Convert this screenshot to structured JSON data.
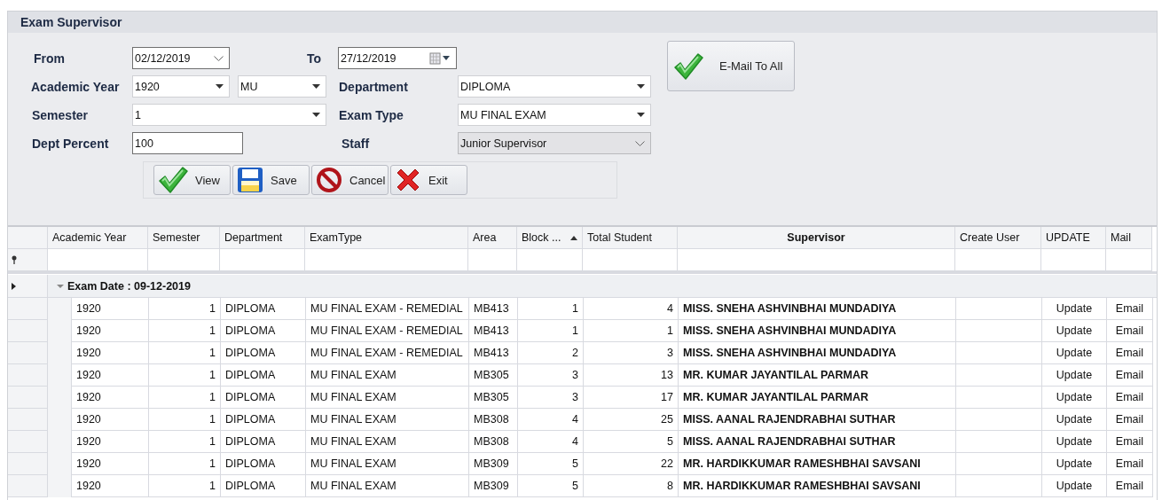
{
  "window": {
    "title": "Exam Supervisor"
  },
  "filters": {
    "from": {
      "label": "From",
      "value": "02/12/2019",
      "kind": "date-dropdown"
    },
    "to": {
      "label": "To",
      "value": "27/12/2019",
      "kind": "date-picker"
    },
    "academic_year": {
      "label": "Academic Year",
      "value": "1920",
      "kind": "combo"
    },
    "university": {
      "value": "MU",
      "kind": "combo"
    },
    "department": {
      "label": "Department",
      "value": "DIPLOMA",
      "kind": "combo"
    },
    "semester": {
      "label": "Semester",
      "value": "1",
      "kind": "combo"
    },
    "exam_type": {
      "label": "Exam Type",
      "value": "MU FINAL EXAM",
      "kind": "combo"
    },
    "dept_percent": {
      "label": "Dept Percent",
      "value": "100",
      "kind": "text"
    },
    "staff": {
      "label": "Staff",
      "value": "Junior Supervisor",
      "kind": "lookup"
    }
  },
  "buttons": [
    {
      "label": "View",
      "kind": "check"
    },
    {
      "label": "Save",
      "kind": "save"
    },
    {
      "label": "Cancel",
      "kind": "cancel"
    },
    {
      "label": "Exit",
      "kind": "exit"
    }
  ],
  "email_button": {
    "label": "E-Mail To All",
    "kind": "check"
  },
  "table": {
    "columns": [
      {
        "label": "Academic Year",
        "kind": "text",
        "sorted": false
      },
      {
        "label": "Semester",
        "kind": "number",
        "sorted": false
      },
      {
        "label": "Department",
        "kind": "text",
        "sorted": false
      },
      {
        "label": "ExamType",
        "kind": "text",
        "sorted": false
      },
      {
        "label": "Area",
        "kind": "text",
        "sorted": false
      },
      {
        "label": "Block ...",
        "kind": "number",
        "sorted": true
      },
      {
        "label": "Total Student",
        "kind": "number",
        "sorted": false
      },
      {
        "label": "Supervisor",
        "kind": "name",
        "sorted": false
      },
      {
        "label": "Create User",
        "kind": "text",
        "sorted": false
      },
      {
        "label": "UPDATE",
        "kind": "action",
        "sorted": false
      },
      {
        "label": "Mail",
        "kind": "action",
        "sorted": false
      }
    ],
    "group": {
      "label": "Exam Date : 09-12-2019",
      "expanded": true,
      "focused": true
    },
    "rows": [
      [
        "1920",
        "1",
        "DIPLOMA",
        "MU FINAL EXAM - REMEDIAL",
        "MB413",
        "1",
        "4",
        "MISS. SNEHA ASHVINBHAI MUNDADIYA",
        null,
        "Update",
        "Email"
      ],
      [
        "1920",
        "1",
        "DIPLOMA",
        "MU FINAL EXAM - REMEDIAL",
        "MB413",
        "1",
        "1",
        "MISS. SNEHA ASHVINBHAI MUNDADIYA",
        null,
        "Update",
        "Email"
      ],
      [
        "1920",
        "1",
        "DIPLOMA",
        "MU FINAL EXAM - REMEDIAL",
        "MB413",
        "2",
        "3",
        "MISS. SNEHA ASHVINBHAI MUNDADIYA",
        null,
        "Update",
        "Email"
      ],
      [
        "1920",
        "1",
        "DIPLOMA",
        "MU FINAL EXAM",
        "MB305",
        "3",
        "13",
        "MR. KUMAR JAYANTILAL PARMAR",
        null,
        "Update",
        "Email"
      ],
      [
        "1920",
        "1",
        "DIPLOMA",
        "MU FINAL EXAM",
        "MB305",
        "3",
        "17",
        "MR. KUMAR JAYANTILAL PARMAR",
        null,
        "Update",
        "Email"
      ],
      [
        "1920",
        "1",
        "DIPLOMA",
        "MU FINAL EXAM",
        "MB308",
        "4",
        "25",
        "MISS. AANAL RAJENDRABHAI SUTHAR",
        null,
        "Update",
        "Email"
      ],
      [
        "1920",
        "1",
        "DIPLOMA",
        "MU FINAL EXAM",
        "MB308",
        "4",
        "5",
        "MISS. AANAL RAJENDRABHAI SUTHAR",
        null,
        "Update",
        "Email"
      ],
      [
        "1920",
        "1",
        "DIPLOMA",
        "MU FINAL EXAM",
        "MB309",
        "5",
        "22",
        "MR. HARDIKKUMAR RAMESHBHAI SAVSANI",
        null,
        "Update",
        "Email"
      ],
      [
        "1920",
        "1",
        "DIPLOMA",
        "MU FINAL EXAM",
        "MB309",
        "5",
        "8",
        "MR. HARDIKKUMAR RAMESHBHAI SAVSANI",
        null,
        "Update",
        "Email"
      ]
    ]
  }
}
